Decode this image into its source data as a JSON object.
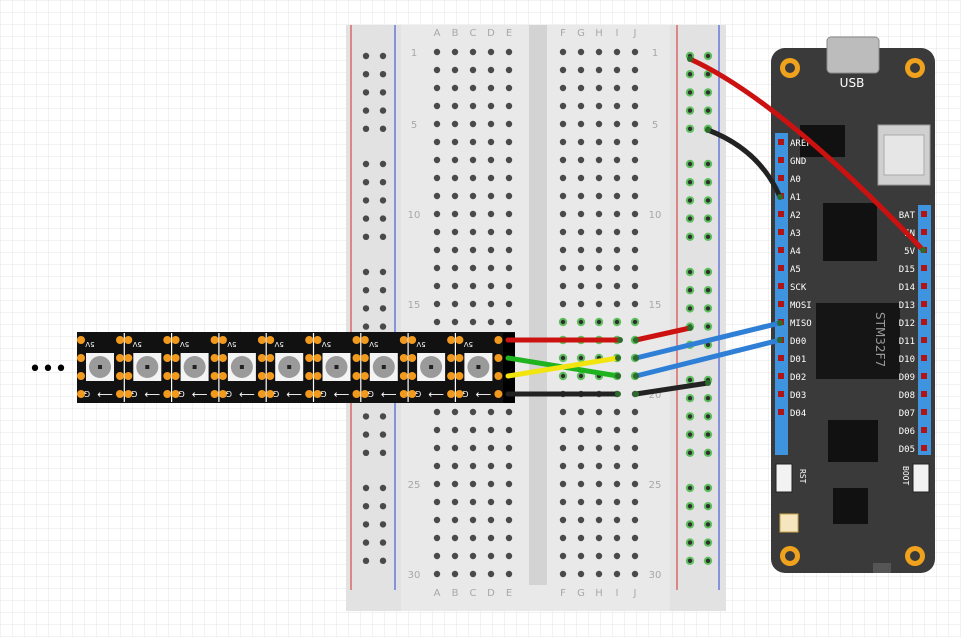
{
  "breadboard": {
    "columns_left": [
      "A",
      "B",
      "C",
      "D",
      "E"
    ],
    "columns_right": [
      "F",
      "G",
      "H",
      "I",
      "J"
    ],
    "row_numbers": [
      "1",
      "5",
      "10",
      "15",
      "20",
      "25",
      "30"
    ]
  },
  "board": {
    "usb_label": "USB",
    "chip_label": "STM32F7",
    "left_pins": [
      "AREF",
      "GND",
      "A0",
      "A1",
      "A2",
      "A3",
      "A4",
      "A5",
      "SCK",
      "MOSI",
      "MISO",
      "D00",
      "D01",
      "D02",
      "D03",
      "D04"
    ],
    "right_pins": [
      "BAT",
      "EN",
      "5V",
      "D15",
      "D14",
      "D13",
      "D12",
      "D11",
      "D10",
      "D09",
      "D08",
      "D07",
      "D06",
      "D05"
    ],
    "rst_label": "RST",
    "boot_label": "BOOT"
  },
  "strip": {
    "ellipsis": "•••",
    "pad_top": "5V",
    "pad_bottom": "G",
    "arrow": "⟵",
    "led_count": 9
  },
  "wires": [
    {
      "name": "5v-wire",
      "color": "#cc1111"
    },
    {
      "name": "data-wire",
      "color": "#1fb31f"
    },
    {
      "name": "clock-wire",
      "color": "#f2e40f"
    },
    {
      "name": "gnd-wire",
      "color": "#222222"
    },
    {
      "name": "sck-wire",
      "color": "#2f7fd6"
    },
    {
      "name": "mosi-wire",
      "color": "#2f7fd6"
    }
  ],
  "colors": {
    "grid": "#e6e6e6",
    "breadboard": "#e9e9e9",
    "board": "#3a3a3a",
    "pin_header": "#3f94e0",
    "mount_hole": "#f0a21c",
    "led_strip": "#111111",
    "pad": "#f19a1e",
    "rail_red": "#d94a4a",
    "rail_blue": "#4a5fd9",
    "green_hole": "#5fbf5f"
  }
}
